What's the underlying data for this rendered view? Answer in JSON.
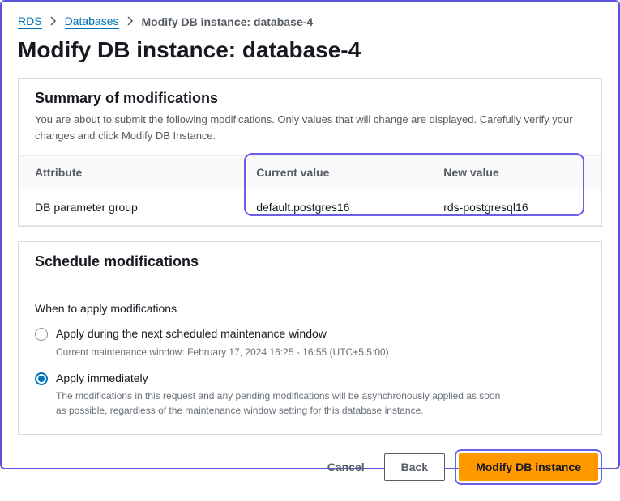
{
  "breadcrumb": {
    "root": "RDS",
    "parent": "Databases",
    "current": "Modify DB instance: database-4"
  },
  "page_title": "Modify DB instance: database-4",
  "summary": {
    "title": "Summary of modifications",
    "desc": "You are about to submit the following modifications. Only values that will change are displayed. Carefully verify your changes and click Modify DB Instance.",
    "columns": {
      "attribute": "Attribute",
      "current": "Current value",
      "new": "New value"
    },
    "rows": [
      {
        "attribute": "DB parameter group",
        "current": "default.postgres16",
        "new": "rds-postgresql16"
      }
    ]
  },
  "schedule": {
    "title": "Schedule modifications",
    "legend": "When to apply modifications",
    "options": [
      {
        "label": "Apply during the next scheduled maintenance window",
        "desc": "Current maintenance window: February 17, 2024 16:25 - 16:55 (UTC+5.5:00)",
        "selected": false
      },
      {
        "label": "Apply immediately",
        "desc": "The modifications in this request and any pending modifications will be asynchronously applied as soon as possible, regardless of the maintenance window setting for this database instance.",
        "selected": true
      }
    ]
  },
  "buttons": {
    "cancel": "Cancel",
    "back": "Back",
    "submit": "Modify DB instance"
  }
}
